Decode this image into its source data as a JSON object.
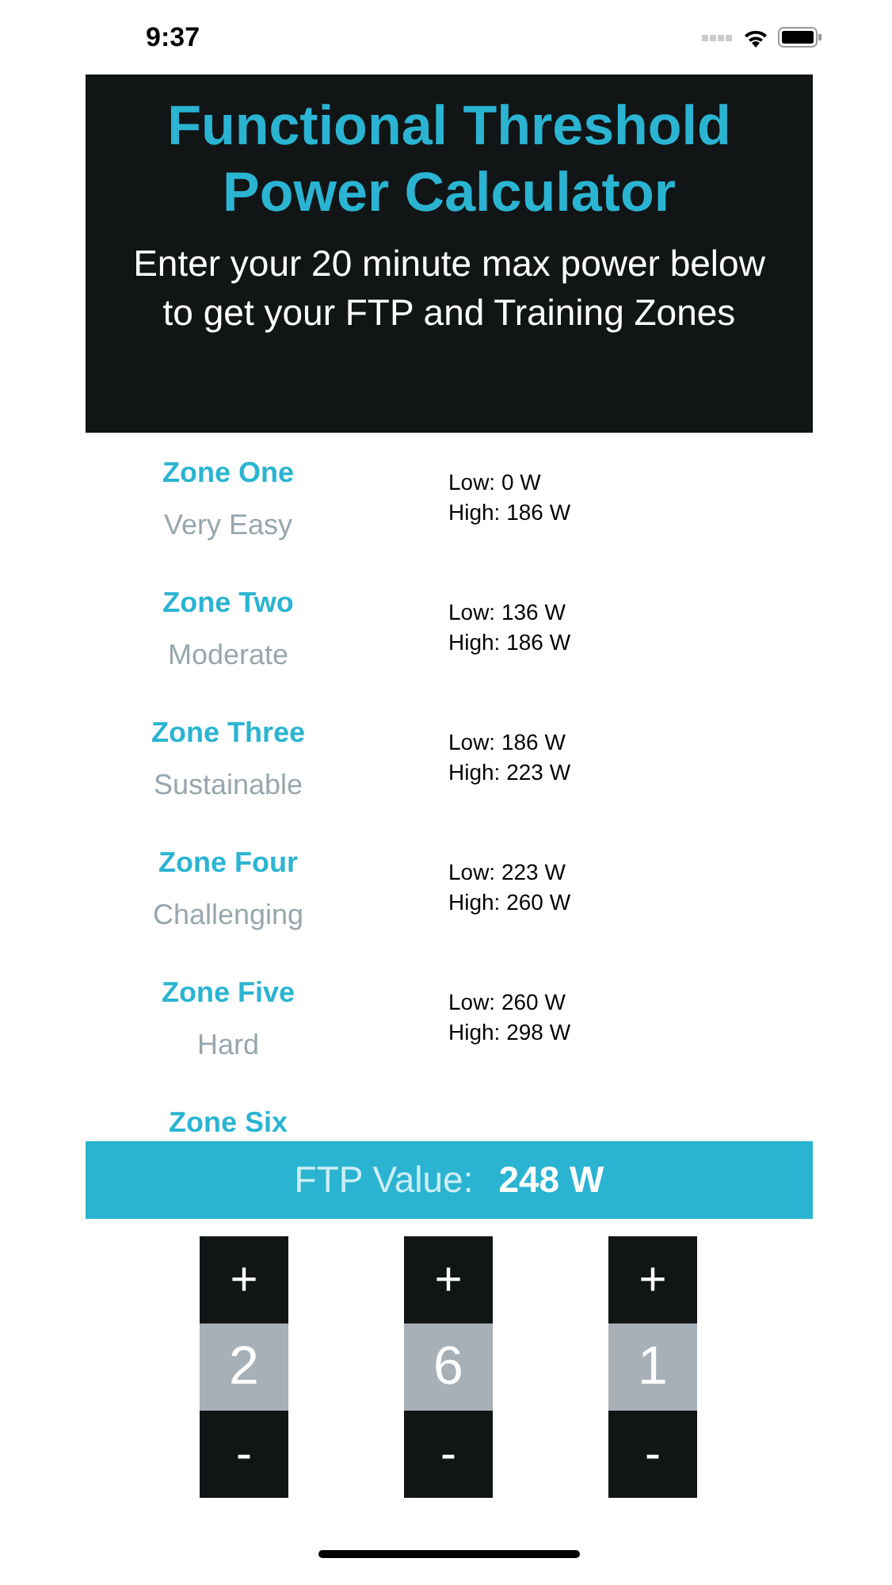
{
  "status_bar": {
    "time": "9:37"
  },
  "header": {
    "title": "Functional Threshold Power Calculator",
    "subtitle": "Enter your 20 minute max power below to get your FTP and Training Zones"
  },
  "zones": [
    {
      "name": "Zone One",
      "description": "Very Easy",
      "low": "Low: 0 W",
      "high": "High: 186 W"
    },
    {
      "name": "Zone Two",
      "description": "Moderate",
      "low": "Low: 136 W",
      "high": "High: 186 W"
    },
    {
      "name": "Zone Three",
      "description": "Sustainable",
      "low": "Low: 186 W",
      "high": "High: 223 W"
    },
    {
      "name": "Zone Four",
      "description": "Challenging",
      "low": "Low: 223 W",
      "high": "High: 260 W"
    },
    {
      "name": "Zone Five",
      "description": "Hard",
      "low": "Low: 260 W",
      "high": "High: 298 W"
    },
    {
      "name": "Zone Six"
    }
  ],
  "ftp": {
    "label": "FTP Value:",
    "value": "248 W"
  },
  "digits": [
    {
      "plus": "+",
      "value": "2",
      "minus": "-"
    },
    {
      "plus": "+",
      "value": "6",
      "minus": "-"
    },
    {
      "plus": "+",
      "value": "1",
      "minus": "-"
    }
  ]
}
